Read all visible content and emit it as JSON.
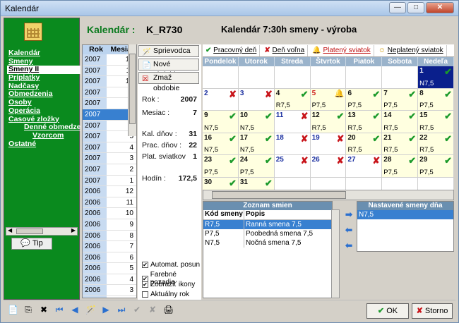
{
  "window": {
    "title": "Kalendár"
  },
  "header": {
    "label": "Kalendár :",
    "code": "K_R730",
    "name": "Kalendár 7:30h smeny - výroba"
  },
  "nav": {
    "items": [
      "Kalendár",
      "Smeny",
      "Smeny II",
      "Príplatky",
      "Nadčasy",
      "Obmedzenia",
      "Osoby",
      "Operácia",
      "Časové zložky",
      "Denné obmedze",
      "Vzorcom",
      "Ostatné"
    ],
    "tip": "Tip"
  },
  "ym": {
    "h_year": "Rok",
    "h_month": "Mesiac",
    "rows": [
      [
        "2007",
        "12"
      ],
      [
        "2007",
        "11"
      ],
      [
        "2007",
        "10"
      ],
      [
        "2007",
        "9"
      ],
      [
        "2007",
        "8"
      ],
      [
        "2007",
        "7"
      ],
      [
        "2007",
        "6"
      ],
      [
        "2007",
        "5"
      ],
      [
        "2007",
        "4"
      ],
      [
        "2007",
        "3"
      ],
      [
        "2007",
        "2"
      ],
      [
        "2007",
        "1"
      ],
      [
        "2006",
        "12"
      ],
      [
        "2006",
        "11"
      ],
      [
        "2006",
        "10"
      ],
      [
        "2006",
        "9"
      ],
      [
        "2006",
        "8"
      ],
      [
        "2006",
        "7"
      ],
      [
        "2006",
        "6"
      ],
      [
        "2006",
        "5"
      ],
      [
        "2006",
        "4"
      ],
      [
        "2006",
        "3"
      ],
      [
        "2006",
        "2"
      ]
    ]
  },
  "side": {
    "sprievodca": "Sprievodca",
    "nove": "Nové obdobie",
    "zmaz": "Zmaž obdobie",
    "rok_l": "Rok :",
    "rok": "2007",
    "mes_l": "Mesiac :",
    "mes": "7",
    "kal_l": "Kal. dňov :",
    "kal": "31",
    "prac_l": "Prac. dňov :",
    "prac": "22",
    "plat_l": "Plat. sviatkov",
    "plat": "1",
    "hod_l": "Hodín :",
    "hod": "172,5",
    "cb1": "Automat. posun",
    "cb2": "Farebné pozadie",
    "cb3": "Zobraziť ikony",
    "cb4": "Aktuálny rok"
  },
  "legend": {
    "a": "Pracovný deň",
    "b": "Deň voľna",
    "c": "Platený sviatok",
    "d": "Neplatený sviatok"
  },
  "days": [
    "Pondelok",
    "Utorok",
    "Streda",
    "Štvrtok",
    "Piatok",
    "Sobota",
    "Nedeľa"
  ],
  "colors": {
    "green": "#0a8a1e",
    "blue": "#3880d0"
  },
  "zs": {
    "title": "Zoznam smien",
    "h1": "Kód smeny",
    "h2": "Popis",
    "rows": [
      [
        "R7,5",
        "Ranná smena 7,5"
      ],
      [
        "P7,5",
        "Poobedná smena 7,5"
      ],
      [
        "N7,5",
        "Nočná smena 7,5"
      ]
    ]
  },
  "ns": {
    "title": "Nastavené smeny dňa",
    "row": "N7,5"
  },
  "buttons": {
    "ok": "OK",
    "storno": "Storno"
  }
}
